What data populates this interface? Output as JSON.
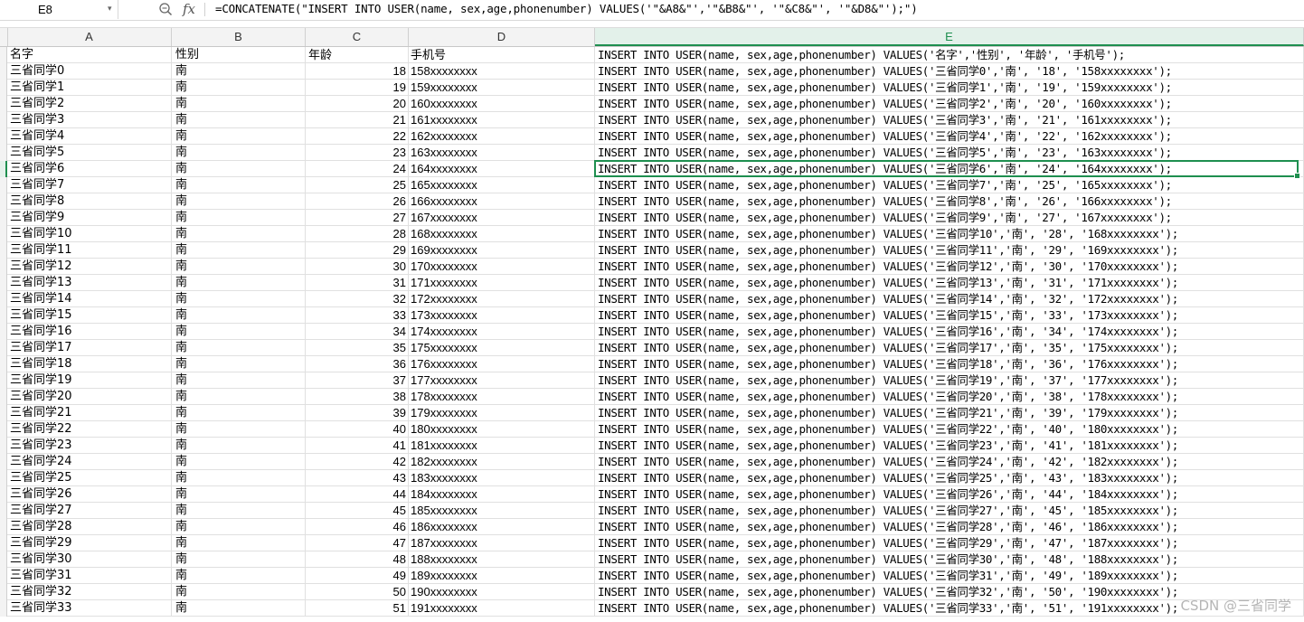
{
  "formula_bar": {
    "cell_ref": "E8",
    "fx_label": "fx",
    "formula": "=CONCATENATE(\"INSERT INTO USER(name, sex,age,phonenumber) VALUES('\"&A8&\"','\"&B8&\"', '\"&C8&\"', '\"&D8&\"');\")"
  },
  "columns": [
    "A",
    "B",
    "C",
    "D",
    "E"
  ],
  "active_column": "E",
  "header_row": {
    "a": "名字",
    "b": "性别",
    "c": "年龄",
    "d": "手机号",
    "e": "INSERT INTO USER(name, sex,age,phonenumber) VALUES('名字','性别', '年龄', '手机号');"
  },
  "rows": [
    {
      "a": "三省同学0",
      "b": "南",
      "c": "18",
      "d": "158xxxxxxxx",
      "e": "INSERT INTO USER(name, sex,age,phonenumber) VALUES('三省同学0','南', '18', '158xxxxxxxx');"
    },
    {
      "a": "三省同学1",
      "b": "南",
      "c": "19",
      "d": "159xxxxxxxx",
      "e": "INSERT INTO USER(name, sex,age,phonenumber) VALUES('三省同学1','南', '19', '159xxxxxxxx');"
    },
    {
      "a": "三省同学2",
      "b": "南",
      "c": "20",
      "d": "160xxxxxxxx",
      "e": "INSERT INTO USER(name, sex,age,phonenumber) VALUES('三省同学2','南', '20', '160xxxxxxxx');"
    },
    {
      "a": "三省同学3",
      "b": "南",
      "c": "21",
      "d": "161xxxxxxxx",
      "e": "INSERT INTO USER(name, sex,age,phonenumber) VALUES('三省同学3','南', '21', '161xxxxxxxx');"
    },
    {
      "a": "三省同学4",
      "b": "南",
      "c": "22",
      "d": "162xxxxxxxx",
      "e": "INSERT INTO USER(name, sex,age,phonenumber) VALUES('三省同学4','南', '22', '162xxxxxxxx');"
    },
    {
      "a": "三省同学5",
      "b": "南",
      "c": "23",
      "d": "163xxxxxxxx",
      "e": "INSERT INTO USER(name, sex,age,phonenumber) VALUES('三省同学5','南', '23', '163xxxxxxxx');"
    },
    {
      "a": "三省同学6",
      "b": "南",
      "c": "24",
      "d": "164xxxxxxxx",
      "e": "INSERT INTO USER(name, sex,age,phonenumber) VALUES('三省同学6','南', '24', '164xxxxxxxx');"
    },
    {
      "a": "三省同学7",
      "b": "南",
      "c": "25",
      "d": "165xxxxxxxx",
      "e": "INSERT INTO USER(name, sex,age,phonenumber) VALUES('三省同学7','南', '25', '165xxxxxxxx');"
    },
    {
      "a": "三省同学8",
      "b": "南",
      "c": "26",
      "d": "166xxxxxxxx",
      "e": "INSERT INTO USER(name, sex,age,phonenumber) VALUES('三省同学8','南', '26', '166xxxxxxxx');"
    },
    {
      "a": "三省同学9",
      "b": "南",
      "c": "27",
      "d": "167xxxxxxxx",
      "e": "INSERT INTO USER(name, sex,age,phonenumber) VALUES('三省同学9','南', '27', '167xxxxxxxx');"
    },
    {
      "a": "三省同学10",
      "b": "南",
      "c": "28",
      "d": "168xxxxxxxx",
      "e": "INSERT INTO USER(name, sex,age,phonenumber) VALUES('三省同学10','南', '28', '168xxxxxxxx');"
    },
    {
      "a": "三省同学11",
      "b": "南",
      "c": "29",
      "d": "169xxxxxxxx",
      "e": "INSERT INTO USER(name, sex,age,phonenumber) VALUES('三省同学11','南', '29', '169xxxxxxxx');"
    },
    {
      "a": "三省同学12",
      "b": "南",
      "c": "30",
      "d": "170xxxxxxxx",
      "e": "INSERT INTO USER(name, sex,age,phonenumber) VALUES('三省同学12','南', '30', '170xxxxxxxx');"
    },
    {
      "a": "三省同学13",
      "b": "南",
      "c": "31",
      "d": "171xxxxxxxx",
      "e": "INSERT INTO USER(name, sex,age,phonenumber) VALUES('三省同学13','南', '31', '171xxxxxxxx');"
    },
    {
      "a": "三省同学14",
      "b": "南",
      "c": "32",
      "d": "172xxxxxxxx",
      "e": "INSERT INTO USER(name, sex,age,phonenumber) VALUES('三省同学14','南', '32', '172xxxxxxxx');"
    },
    {
      "a": "三省同学15",
      "b": "南",
      "c": "33",
      "d": "173xxxxxxxx",
      "e": "INSERT INTO USER(name, sex,age,phonenumber) VALUES('三省同学15','南', '33', '173xxxxxxxx');"
    },
    {
      "a": "三省同学16",
      "b": "南",
      "c": "34",
      "d": "174xxxxxxxx",
      "e": "INSERT INTO USER(name, sex,age,phonenumber) VALUES('三省同学16','南', '34', '174xxxxxxxx');"
    },
    {
      "a": "三省同学17",
      "b": "南",
      "c": "35",
      "d": "175xxxxxxxx",
      "e": "INSERT INTO USER(name, sex,age,phonenumber) VALUES('三省同学17','南', '35', '175xxxxxxxx');"
    },
    {
      "a": "三省同学18",
      "b": "南",
      "c": "36",
      "d": "176xxxxxxxx",
      "e": "INSERT INTO USER(name, sex,age,phonenumber) VALUES('三省同学18','南', '36', '176xxxxxxxx');"
    },
    {
      "a": "三省同学19",
      "b": "南",
      "c": "37",
      "d": "177xxxxxxxx",
      "e": "INSERT INTO USER(name, sex,age,phonenumber) VALUES('三省同学19','南', '37', '177xxxxxxxx');"
    },
    {
      "a": "三省同学20",
      "b": "南",
      "c": "38",
      "d": "178xxxxxxxx",
      "e": "INSERT INTO USER(name, sex,age,phonenumber) VALUES('三省同学20','南', '38', '178xxxxxxxx');"
    },
    {
      "a": "三省同学21",
      "b": "南",
      "c": "39",
      "d": "179xxxxxxxx",
      "e": "INSERT INTO USER(name, sex,age,phonenumber) VALUES('三省同学21','南', '39', '179xxxxxxxx');"
    },
    {
      "a": "三省同学22",
      "b": "南",
      "c": "40",
      "d": "180xxxxxxxx",
      "e": "INSERT INTO USER(name, sex,age,phonenumber) VALUES('三省同学22','南', '40', '180xxxxxxxx');"
    },
    {
      "a": "三省同学23",
      "b": "南",
      "c": "41",
      "d": "181xxxxxxxx",
      "e": "INSERT INTO USER(name, sex,age,phonenumber) VALUES('三省同学23','南', '41', '181xxxxxxxx');"
    },
    {
      "a": "三省同学24",
      "b": "南",
      "c": "42",
      "d": "182xxxxxxxx",
      "e": "INSERT INTO USER(name, sex,age,phonenumber) VALUES('三省同学24','南', '42', '182xxxxxxxx');"
    },
    {
      "a": "三省同学25",
      "b": "南",
      "c": "43",
      "d": "183xxxxxxxx",
      "e": "INSERT INTO USER(name, sex,age,phonenumber) VALUES('三省同学25','南', '43', '183xxxxxxxx');"
    },
    {
      "a": "三省同学26",
      "b": "南",
      "c": "44",
      "d": "184xxxxxxxx",
      "e": "INSERT INTO USER(name, sex,age,phonenumber) VALUES('三省同学26','南', '44', '184xxxxxxxx');"
    },
    {
      "a": "三省同学27",
      "b": "南",
      "c": "45",
      "d": "185xxxxxxxx",
      "e": "INSERT INTO USER(name, sex,age,phonenumber) VALUES('三省同学27','南', '45', '185xxxxxxxx');"
    },
    {
      "a": "三省同学28",
      "b": "南",
      "c": "46",
      "d": "186xxxxxxxx",
      "e": "INSERT INTO USER(name, sex,age,phonenumber) VALUES('三省同学28','南', '46', '186xxxxxxxx');"
    },
    {
      "a": "三省同学29",
      "b": "南",
      "c": "47",
      "d": "187xxxxxxxx",
      "e": "INSERT INTO USER(name, sex,age,phonenumber) VALUES('三省同学29','南', '47', '187xxxxxxxx');"
    },
    {
      "a": "三省同学30",
      "b": "南",
      "c": "48",
      "d": "188xxxxxxxx",
      "e": "INSERT INTO USER(name, sex,age,phonenumber) VALUES('三省同学30','南', '48', '188xxxxxxxx');"
    },
    {
      "a": "三省同学31",
      "b": "南",
      "c": "49",
      "d": "189xxxxxxxx",
      "e": "INSERT INTO USER(name, sex,age,phonenumber) VALUES('三省同学31','南', '49', '189xxxxxxxx');"
    },
    {
      "a": "三省同学32",
      "b": "南",
      "c": "50",
      "d": "190xxxxxxxx",
      "e": "INSERT INTO USER(name, sex,age,phonenumber) VALUES('三省同学32','南', '50', '190xxxxxxxx');"
    },
    {
      "a": "三省同学33",
      "b": "南",
      "c": "51",
      "d": "191xxxxxxxx",
      "e": "INSERT INTO USER(name, sex,age,phonenumber) VALUES('三省同学33','南', '51', '191xxxxxxxx');"
    }
  ],
  "active_row_index": 6,
  "watermark": "CSDN @三省同学",
  "colors": {
    "accent": "#1e8f4f",
    "header_bg": "#f3f3f3",
    "gridline": "#e0e0e0"
  }
}
